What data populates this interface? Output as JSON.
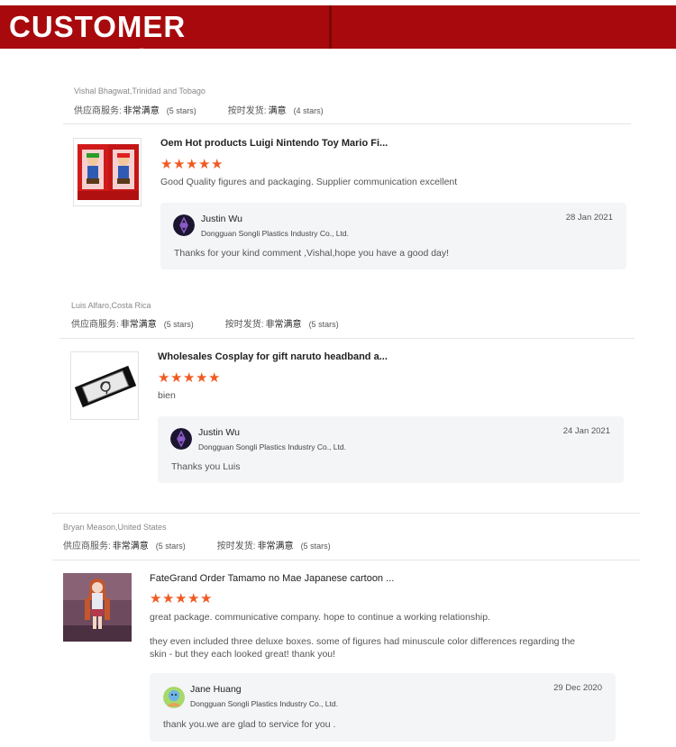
{
  "header": {
    "title": "CUSTOMER REVIEWS"
  },
  "labels": {
    "supplier_service": "供应商服务:",
    "on_time_shipping": "按时发货:"
  },
  "reviews": [
    {
      "reviewer": "Vishal Bhagwat,Trinidad and Tobago",
      "supplier_service_value": "非常满意",
      "supplier_service_stars": "(5 stars)",
      "shipping_value": "满意",
      "shipping_stars": "(4 stars)",
      "product_title": "Oem Hot products Luigi Nintendo Toy Mario Fi...",
      "rating": 5,
      "comment": "Good Quality figures and packaging. Supplier communication excellent",
      "comment2": "",
      "reply": {
        "name": "Justin Wu",
        "company": "Dongguan Songli Plastics Industry Co., Ltd.",
        "date": "28 Jan 2021",
        "text": "Thanks for your kind comment ,Vishal,hope you have a good day!"
      }
    },
    {
      "reviewer": "Luis Alfaro,Costa Rica",
      "supplier_service_value": "非常满意",
      "supplier_service_stars": "(5 stars)",
      "shipping_value": "非常满意",
      "shipping_stars": "(5 stars)",
      "product_title": "Wholesales Cosplay for gift naruto headband a...",
      "rating": 5,
      "comment": "bien",
      "comment2": "",
      "reply": {
        "name": "Justin Wu",
        "company": "Dongguan Songli Plastics Industry Co., Ltd.",
        "date": "24 Jan 2021",
        "text": "Thanks you Luis"
      }
    },
    {
      "reviewer": "Bryan Meason,United States",
      "supplier_service_value": "非常满意",
      "supplier_service_stars": "(5 stars)",
      "shipping_value": "非常满意",
      "shipping_stars": "(5 stars)",
      "product_title": "FateGrand Order Tamamo no Mae Japanese cartoon ...",
      "rating": 5,
      "comment": "great package. communicative company. hope to continue a working relationship.",
      "comment2": "they even included three deluxe boxes. some of figures had minuscule color differences regarding the skin - but they each looked great! thank you!",
      "reply": {
        "name": "Jane Huang",
        "company": "Dongguan Songli Plastics Industry Co., Ltd.",
        "date": "29 Dec 2020",
        "text": "thank you.we are glad to service for you ."
      }
    }
  ],
  "colors": {
    "banner": "#a8090c",
    "star": "#f05a22",
    "reply_bg": "#f4f5f7"
  }
}
